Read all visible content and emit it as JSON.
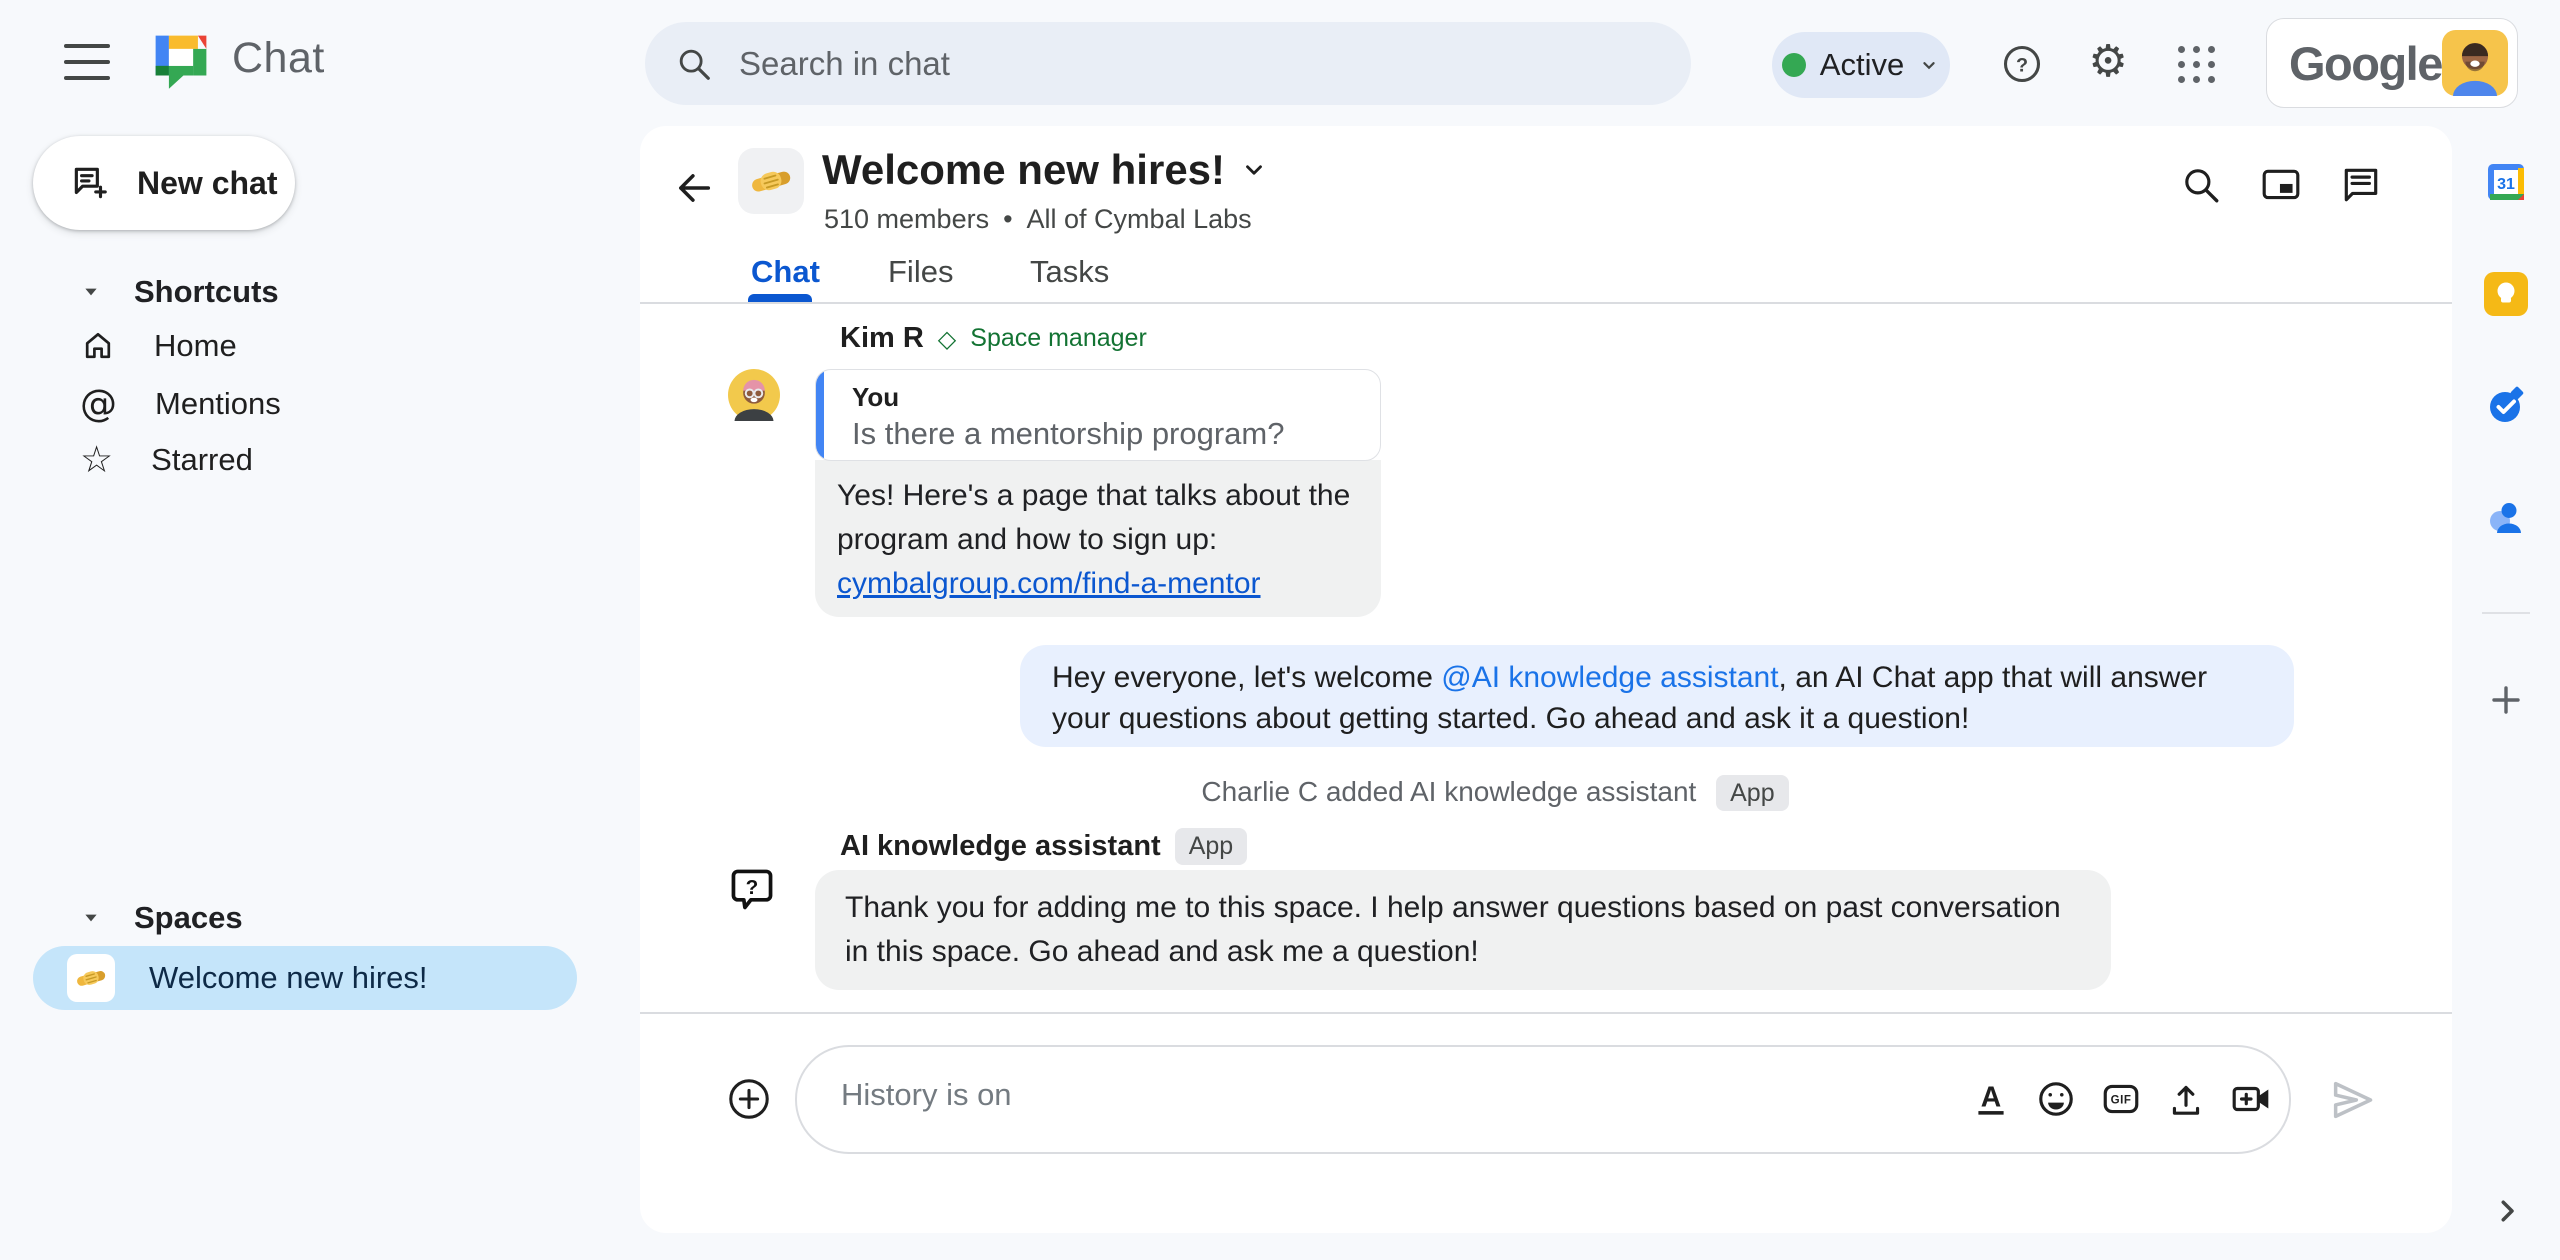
{
  "topbar": {
    "app_name": "Chat",
    "search_placeholder": "Search in chat",
    "status_label": "Active",
    "help_glyph": "?",
    "wordmark": "Google"
  },
  "sidebar": {
    "new_chat_label": "New chat",
    "shortcuts": {
      "label": "Shortcuts",
      "items": [
        {
          "label": "Home"
        },
        {
          "label": "Mentions"
        },
        {
          "label": "Starred"
        }
      ]
    },
    "spaces": {
      "label": "Spaces",
      "items": [
        {
          "label": "Welcome new hires!",
          "selected": true
        }
      ]
    }
  },
  "space": {
    "title": "Welcome new hires!",
    "members": "510 members",
    "separator": "•",
    "org": "All of Cymbal Labs",
    "tabs": [
      {
        "label": "Chat",
        "active": true
      },
      {
        "label": "Files",
        "active": false
      },
      {
        "label": "Tasks",
        "active": false
      }
    ]
  },
  "conversation": {
    "message1": {
      "sender": "Kim R",
      "role_icon": "◇",
      "role": "Space manager",
      "quote_author": "You",
      "quote_text": "Is there a mentorship program?",
      "reply_text": "Yes! Here's a page that talks about the program and how to sign up: ",
      "reply_link": "cymbalgroup.com/find-a-mentor"
    },
    "message2": {
      "text_before": "Hey everyone, let's welcome ",
      "mention": "@AI knowledge assistant",
      "text_after": ", an AI Chat app that will answer your questions about getting started.  Go ahead and ask it a question!"
    },
    "system_event": {
      "text": "Charlie C added AI knowledge assistant",
      "badge": "App"
    },
    "message3": {
      "sender": "AI knowledge assistant",
      "badge": "App",
      "avatar_glyph": "?",
      "text": "Thank you for adding me to this space. I help answer questions based on past conversation in this space. Go ahead and ask me a question!"
    }
  },
  "composer": {
    "placeholder": "History is on",
    "format_glyph": "A",
    "gif_label": "GIF"
  },
  "rail": {
    "calendar_label": "31"
  },
  "icons_glyphs": {
    "mention_at": "@",
    "star": "☆",
    "gear": "⚙",
    "history": "History is on"
  },
  "colors": {
    "page_bg": "#F7F9FC",
    "search_bg": "#E9EEF6",
    "accent_blue": "#0B57D0",
    "link_blue": "#1A73E8",
    "selected_space_bg": "#C5E5FA",
    "bubble_gray": "#F0F1F1",
    "bubble_blue": "#E8F0FE",
    "badge_bg": "#E7E8EB",
    "manager_green": "#137333",
    "status_green": "#34A853"
  }
}
